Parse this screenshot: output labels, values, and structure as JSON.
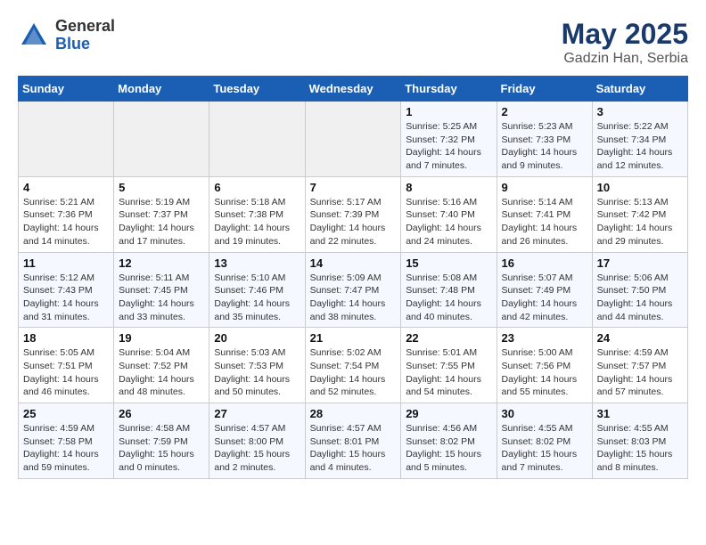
{
  "header": {
    "logo": {
      "general": "General",
      "blue": "Blue"
    },
    "title": "May 2025",
    "location": "Gadzin Han, Serbia"
  },
  "weekdays": [
    "Sunday",
    "Monday",
    "Tuesday",
    "Wednesday",
    "Thursday",
    "Friday",
    "Saturday"
  ],
  "weeks": [
    [
      {
        "day": "",
        "detail": ""
      },
      {
        "day": "",
        "detail": ""
      },
      {
        "day": "",
        "detail": ""
      },
      {
        "day": "",
        "detail": ""
      },
      {
        "day": "1",
        "detail": "Sunrise: 5:25 AM\nSunset: 7:32 PM\nDaylight: 14 hours\nand 7 minutes."
      },
      {
        "day": "2",
        "detail": "Sunrise: 5:23 AM\nSunset: 7:33 PM\nDaylight: 14 hours\nand 9 minutes."
      },
      {
        "day": "3",
        "detail": "Sunrise: 5:22 AM\nSunset: 7:34 PM\nDaylight: 14 hours\nand 12 minutes."
      }
    ],
    [
      {
        "day": "4",
        "detail": "Sunrise: 5:21 AM\nSunset: 7:36 PM\nDaylight: 14 hours\nand 14 minutes."
      },
      {
        "day": "5",
        "detail": "Sunrise: 5:19 AM\nSunset: 7:37 PM\nDaylight: 14 hours\nand 17 minutes."
      },
      {
        "day": "6",
        "detail": "Sunrise: 5:18 AM\nSunset: 7:38 PM\nDaylight: 14 hours\nand 19 minutes."
      },
      {
        "day": "7",
        "detail": "Sunrise: 5:17 AM\nSunset: 7:39 PM\nDaylight: 14 hours\nand 22 minutes."
      },
      {
        "day": "8",
        "detail": "Sunrise: 5:16 AM\nSunset: 7:40 PM\nDaylight: 14 hours\nand 24 minutes."
      },
      {
        "day": "9",
        "detail": "Sunrise: 5:14 AM\nSunset: 7:41 PM\nDaylight: 14 hours\nand 26 minutes."
      },
      {
        "day": "10",
        "detail": "Sunrise: 5:13 AM\nSunset: 7:42 PM\nDaylight: 14 hours\nand 29 minutes."
      }
    ],
    [
      {
        "day": "11",
        "detail": "Sunrise: 5:12 AM\nSunset: 7:43 PM\nDaylight: 14 hours\nand 31 minutes."
      },
      {
        "day": "12",
        "detail": "Sunrise: 5:11 AM\nSunset: 7:45 PM\nDaylight: 14 hours\nand 33 minutes."
      },
      {
        "day": "13",
        "detail": "Sunrise: 5:10 AM\nSunset: 7:46 PM\nDaylight: 14 hours\nand 35 minutes."
      },
      {
        "day": "14",
        "detail": "Sunrise: 5:09 AM\nSunset: 7:47 PM\nDaylight: 14 hours\nand 38 minutes."
      },
      {
        "day": "15",
        "detail": "Sunrise: 5:08 AM\nSunset: 7:48 PM\nDaylight: 14 hours\nand 40 minutes."
      },
      {
        "day": "16",
        "detail": "Sunrise: 5:07 AM\nSunset: 7:49 PM\nDaylight: 14 hours\nand 42 minutes."
      },
      {
        "day": "17",
        "detail": "Sunrise: 5:06 AM\nSunset: 7:50 PM\nDaylight: 14 hours\nand 44 minutes."
      }
    ],
    [
      {
        "day": "18",
        "detail": "Sunrise: 5:05 AM\nSunset: 7:51 PM\nDaylight: 14 hours\nand 46 minutes."
      },
      {
        "day": "19",
        "detail": "Sunrise: 5:04 AM\nSunset: 7:52 PM\nDaylight: 14 hours\nand 48 minutes."
      },
      {
        "day": "20",
        "detail": "Sunrise: 5:03 AM\nSunset: 7:53 PM\nDaylight: 14 hours\nand 50 minutes."
      },
      {
        "day": "21",
        "detail": "Sunrise: 5:02 AM\nSunset: 7:54 PM\nDaylight: 14 hours\nand 52 minutes."
      },
      {
        "day": "22",
        "detail": "Sunrise: 5:01 AM\nSunset: 7:55 PM\nDaylight: 14 hours\nand 54 minutes."
      },
      {
        "day": "23",
        "detail": "Sunrise: 5:00 AM\nSunset: 7:56 PM\nDaylight: 14 hours\nand 55 minutes."
      },
      {
        "day": "24",
        "detail": "Sunrise: 4:59 AM\nSunset: 7:57 PM\nDaylight: 14 hours\nand 57 minutes."
      }
    ],
    [
      {
        "day": "25",
        "detail": "Sunrise: 4:59 AM\nSunset: 7:58 PM\nDaylight: 14 hours\nand 59 minutes."
      },
      {
        "day": "26",
        "detail": "Sunrise: 4:58 AM\nSunset: 7:59 PM\nDaylight: 15 hours\nand 0 minutes."
      },
      {
        "day": "27",
        "detail": "Sunrise: 4:57 AM\nSunset: 8:00 PM\nDaylight: 15 hours\nand 2 minutes."
      },
      {
        "day": "28",
        "detail": "Sunrise: 4:57 AM\nSunset: 8:01 PM\nDaylight: 15 hours\nand 4 minutes."
      },
      {
        "day": "29",
        "detail": "Sunrise: 4:56 AM\nSunset: 8:02 PM\nDaylight: 15 hours\nand 5 minutes."
      },
      {
        "day": "30",
        "detail": "Sunrise: 4:55 AM\nSunset: 8:02 PM\nDaylight: 15 hours\nand 7 minutes."
      },
      {
        "day": "31",
        "detail": "Sunrise: 4:55 AM\nSunset: 8:03 PM\nDaylight: 15 hours\nand 8 minutes."
      }
    ]
  ]
}
